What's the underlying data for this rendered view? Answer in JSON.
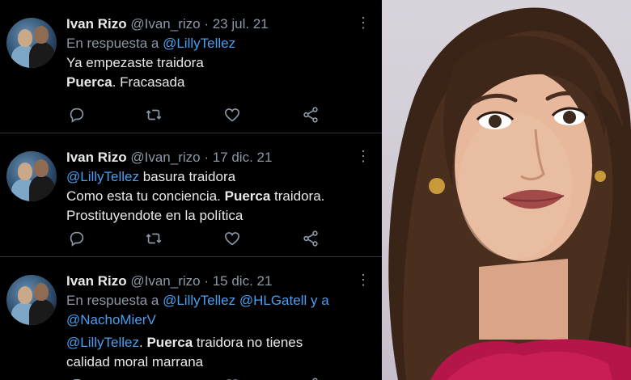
{
  "tweets": [
    {
      "name": "Ivan Rizo",
      "handle": "@Ivan_rizo",
      "date": "23 jul. 21",
      "reply_prefix": "En respuesta a",
      "reply_to_1": "@LillyTellez",
      "line1": "Ya empezaste traidora",
      "line2_bold": "Puerca",
      "line2_rest": ". Fracasada"
    },
    {
      "name": "Ivan Rizo",
      "handle": "@Ivan_rizo",
      "date": "17 dic. 21",
      "mention": "@LillyTellez",
      "line1_rest": " basura traidora",
      "line2_a": "Como esta tu conciencia. ",
      "line2_bold": "Puerca",
      "line2_b": " traidora.",
      "line3": "Prostituyendote en la política"
    },
    {
      "name": "Ivan Rizo",
      "handle": "@Ivan_rizo",
      "date": "15 dic. 21",
      "reply_prefix": "En respuesta a",
      "reply_to_1": "@LillyTellez",
      "reply_to_2": "@HLGatell",
      "reply_and": "y a",
      "reply_to_3": "@NachoMierV",
      "mention": "@LillyTellez",
      "line1_a": ". ",
      "line1_bold": "Puerca",
      "line1_b": " traidora no tienes",
      "line2": "calidad moral marrana"
    }
  ],
  "separator": " · ",
  "icons": {
    "reply": "reply-icon",
    "retweet": "retweet-icon",
    "like": "heart-icon",
    "share": "share-icon",
    "more": "more-icon"
  },
  "colors": {
    "background": "#000000",
    "text": "#e7e9ea",
    "muted": "#8b98a5",
    "link": "#4a9ff0",
    "photo_background": "#d9d4dc"
  }
}
